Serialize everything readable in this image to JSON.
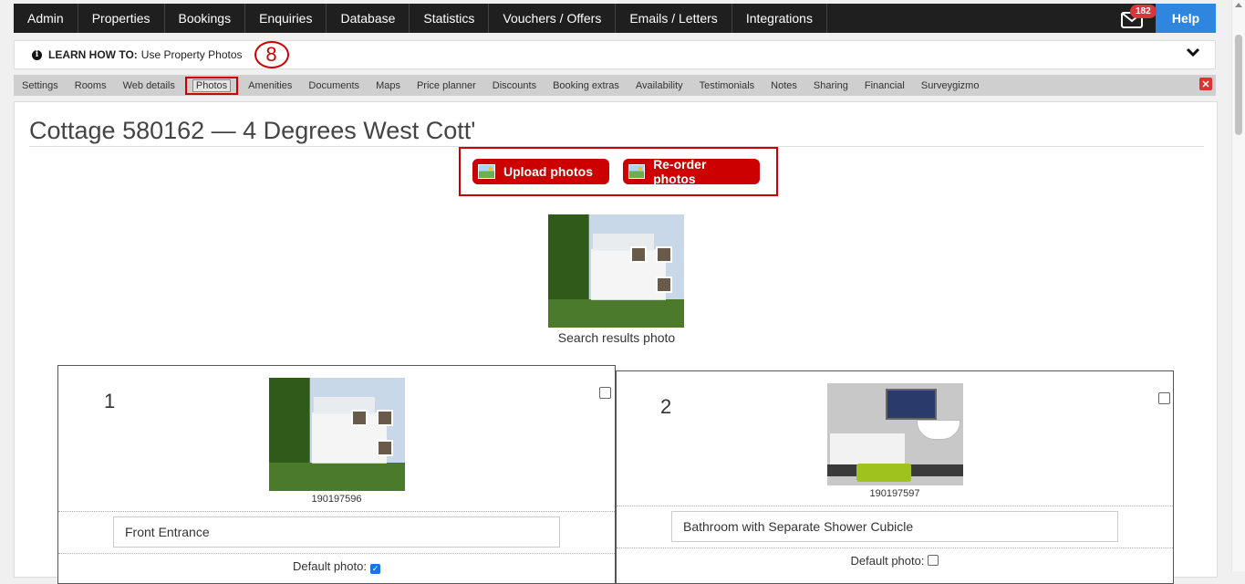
{
  "topnav": {
    "items": [
      "Admin",
      "Properties",
      "Bookings",
      "Enquiries",
      "Database",
      "Statistics",
      "Vouchers / Offers",
      "Emails / Letters",
      "Integrations"
    ],
    "mail_count": "182",
    "help_label": "Help"
  },
  "learn": {
    "prefix": "LEARN HOW TO:",
    "text": "Use Property Photos",
    "step": "8"
  },
  "tabs": [
    "Settings",
    "Rooms",
    "Web details",
    "Photos",
    "Amenities",
    "Documents",
    "Maps",
    "Price planner",
    "Discounts",
    "Booking extras",
    "Availability",
    "Testimonials",
    "Notes",
    "Sharing",
    "Financial",
    "Surveygizmo"
  ],
  "active_tab": "Photos",
  "page": {
    "title": "Cottage 580162 — 4 Degrees West Cott'",
    "upload_label": "Upload photos",
    "reorder_label": "Re-order photos",
    "search_caption": "Search results photo"
  },
  "photos": [
    {
      "number": "1",
      "id": "190197596",
      "description": "Front Entrance",
      "default_label": "Default photo:",
      "is_default": true
    },
    {
      "number": "2",
      "id": "190197597",
      "description": "Bathroom with Separate Shower Cubicle",
      "default_label": "Default photo:",
      "is_default": false
    }
  ],
  "colors": {
    "accent": "#cc0000",
    "nav_bg": "#1f1f1f",
    "help_bg": "#2e86de"
  }
}
